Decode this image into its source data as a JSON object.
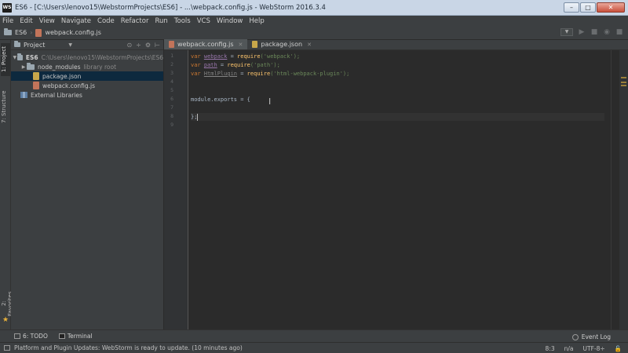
{
  "window": {
    "app_icon": "WS",
    "title": "ES6 - [C:\\Users\\lenovo15\\WebstormProjects\\ES6] - ...\\webpack.config.js - WebStorm 2016.3.4",
    "minimize": "–",
    "maximize": "□",
    "close": "✕"
  },
  "menu": [
    "File",
    "Edit",
    "View",
    "Navigate",
    "Code",
    "Refactor",
    "Run",
    "Tools",
    "VCS",
    "Window",
    "Help"
  ],
  "navbar": {
    "crumbs": [
      "ES6",
      "webpack.config.js"
    ],
    "run_config_icon": "dropdown-icon"
  },
  "left_stripe": {
    "project_tab": "1: Project",
    "structure_tab": "7: Structure",
    "favorites_tab": "2: Favorites"
  },
  "project_panel": {
    "view_selector": "Project",
    "tree": {
      "root_name": "ES6",
      "root_path": "C:\\Users\\lenovo15\\WebstormProjects\\ES6",
      "node_modules": "node_modules",
      "node_modules_note": "library root",
      "package_json": "package.json",
      "webpack_config": "webpack.config.js",
      "external_libraries": "External Libraries"
    }
  },
  "editor": {
    "tabs": [
      {
        "label": "webpack.config.js",
        "active": true
      },
      {
        "label": "package.json",
        "active": false
      }
    ],
    "line_numbers": [
      "1",
      "2",
      "3",
      "4",
      "5",
      "6",
      "7",
      "8",
      "9"
    ],
    "code": {
      "l1_kw": "var ",
      "l1_var": "webpack",
      "l1_eq": " = ",
      "l1_fn": "require",
      "l1_str": "('webpack');",
      "l2_kw": "var ",
      "l2_var": "path",
      "l2_eq": " = ",
      "l2_fn": "require",
      "l2_str": "('path');",
      "l3_kw": "var ",
      "l3_var": "HtmlPlugin",
      "l3_eq": " = ",
      "l3_fn": "require",
      "l3_str": "('html-webpack-plugin');",
      "l6": "module.exports = {",
      "l8": "};"
    }
  },
  "bottom_bar": {
    "todo": "6: TODO",
    "terminal": "Terminal",
    "event_log": "Event Log"
  },
  "status": {
    "message": "Platform and Plugin Updates: WebStorm is ready to update. (10 minutes ago)",
    "position": "8:3",
    "na": "n/a",
    "encoding": "UTF-8÷"
  }
}
